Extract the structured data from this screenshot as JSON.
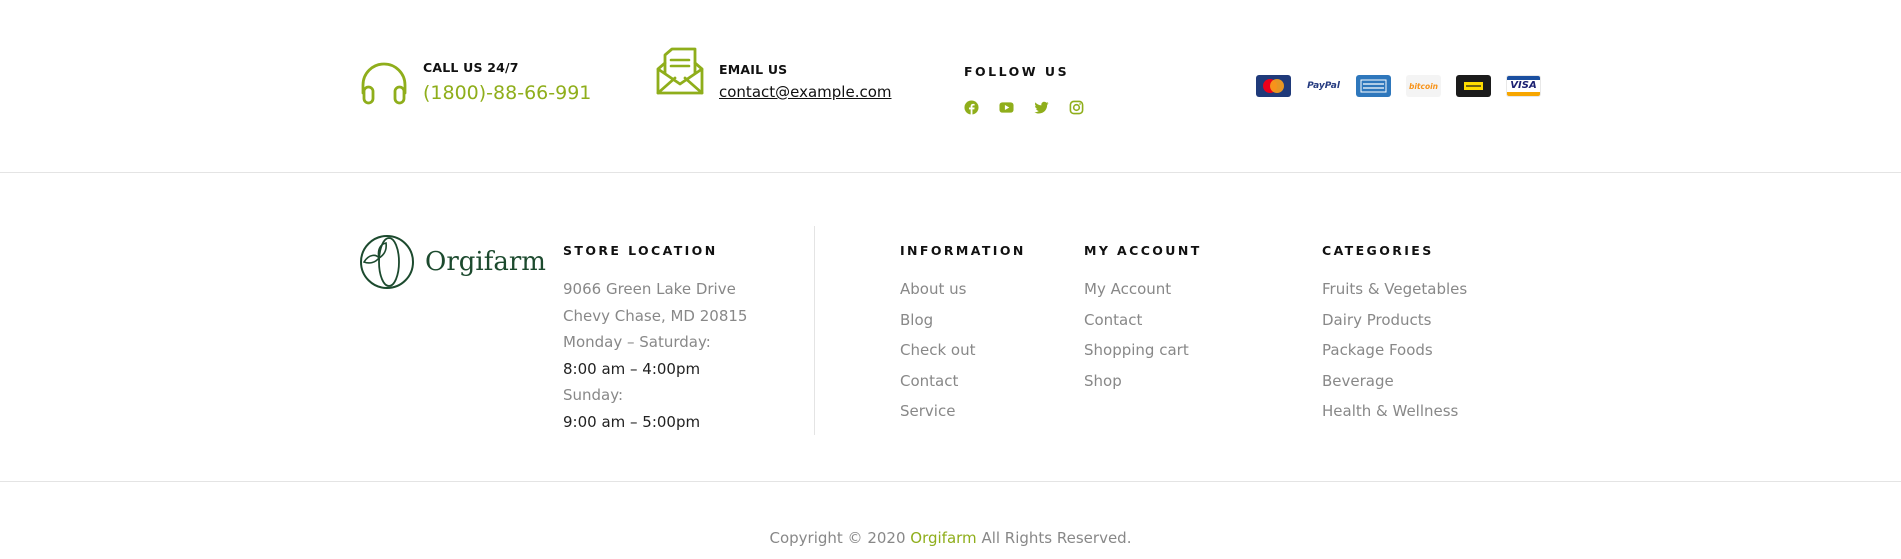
{
  "contacts": {
    "call_label": "CALL US 24/7",
    "phone": "(1800)-88-66-991",
    "email_label": "EMAIL US",
    "email": "contact@example.com"
  },
  "follow": {
    "title": "FOLLOW US",
    "icons": [
      "facebook-icon",
      "youtube-icon",
      "twitter-icon",
      "instagram-icon"
    ]
  },
  "payments": [
    {
      "name": "mastercard-card",
      "label": "MasterCard"
    },
    {
      "name": "paypal-card",
      "label": "PayPal"
    },
    {
      "name": "amex-card",
      "label": "AMERICAN EXPRESS"
    },
    {
      "name": "bitcoin-card",
      "label": "bitcoin"
    },
    {
      "name": "western-union-card",
      "label": "WESTERN UNION"
    },
    {
      "name": "visa-card",
      "label": "VISA"
    }
  ],
  "brand": {
    "name": "Orgifarm"
  },
  "store": {
    "title": "STORE LOCATION",
    "address_line1": "9066 Green Lake Drive",
    "address_line2": "Chevy Chase, MD 20815",
    "weekday_label": "Monday – Saturday:",
    "weekday_hours": "8:00 am – 4:00pm",
    "sunday_label": "Sunday:",
    "sunday_hours": "9:00 am – 5:00pm"
  },
  "information": {
    "title": "INFORMATION",
    "links": [
      "About us",
      "Blog",
      "Check out",
      "Contact",
      "Service"
    ]
  },
  "account": {
    "title": "MY ACCOUNT",
    "links": [
      "My Account",
      "Contact",
      "Shopping cart",
      "Shop"
    ]
  },
  "categories": {
    "title": "CATEGORIES",
    "links": [
      "Fruits & Vegetables",
      "Dairy Products",
      "Package Foods",
      "Beverage",
      "Health & Wellness"
    ]
  },
  "copyright": {
    "prefix": "Copyright © 2020 ",
    "brand": "Orgifarm",
    "suffix": " All Rights Reserved."
  },
  "colors": {
    "accent": "#8fae1b",
    "brand_green": "#1c4a2e",
    "muted_text": "#888888",
    "divider": "#e4e4e4"
  }
}
